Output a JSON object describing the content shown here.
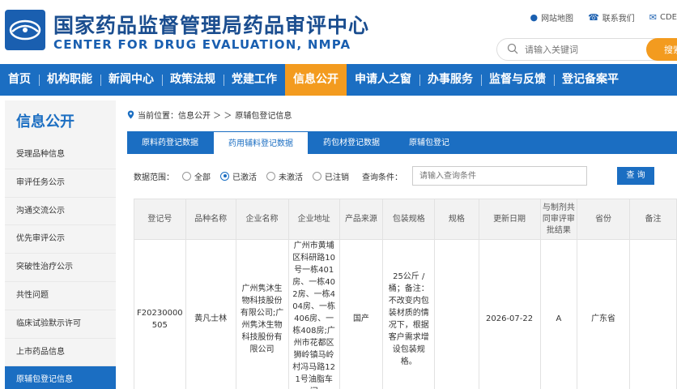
{
  "header": {
    "title": "国家药品监督管理局药品审评中心",
    "subtitle": "CENTER FOR DRUG EVALUATION, NMPA",
    "links": [
      "网站地图",
      "联系我们",
      "CDE"
    ],
    "search_placeholder": "请输入关键词",
    "search_button": "搜索"
  },
  "nav": [
    "首页",
    "机构职能",
    "新闻中心",
    "政策法规",
    "党建工作",
    "信息公开",
    "申请人之窗",
    "办事服务",
    "监督与反馈",
    "登记备案平"
  ],
  "sidebar": {
    "title": "信息公开",
    "items": [
      "受理品种信息",
      "审评任务公示",
      "沟通交流公示",
      "优先审评公示",
      "突破性治疗公示",
      "共性问题",
      "临床试验默示许可",
      "上市药品信息",
      "原辅包登记信息"
    ]
  },
  "breadcrumb": {
    "prefix": "当前位置：信息公开 ＞ ＞",
    "current": "原辅包登记信息"
  },
  "tabs": [
    "原料药登记数据",
    "药用辅料登记数据",
    "药包材登记数据",
    "原辅包登记"
  ],
  "filter": {
    "scope_label": "数据范围：",
    "options": [
      "全部",
      "已激活",
      "未激活",
      "已注销"
    ],
    "selected": "已激活",
    "condition_label": "查询条件：",
    "condition_placeholder": "请输入查询条件",
    "query_button": "查 询"
  },
  "table": {
    "headers": [
      "登记号",
      "品种名称",
      "企业名称",
      "企业地址",
      "产品来源",
      "包装规格",
      "规格",
      "更新日期",
      "与制剂共同审评审批结果",
      "省份",
      "备注"
    ],
    "rows": [
      [
        "F20230000505",
        "黄凡士林",
        "广州隽沐生物科技股份有限公司;广州隽沐生物科技股份有限公司",
        "广州市黄埔区科研路10号一栋401房、一栋402房、一栋404房、一栋406房、一栋408房;广州市花都区狮岭镇马岭村冯马路121号油脂车间",
        "国产",
        "25公斤 / 桶；备注：不改变内包装材质的情况下，根据客户需求增设包装规格。",
        "",
        "2026-07-22",
        "A",
        "广东省",
        ""
      ]
    ]
  },
  "colors": {
    "nav_blue": "#1b6ec2",
    "accent_orange": "#f39b1f",
    "title_blue": "#1a4d8f"
  }
}
